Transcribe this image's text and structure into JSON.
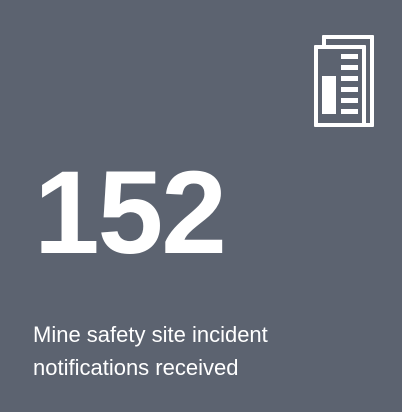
{
  "tile": {
    "icon": "document-report-icon",
    "value": "152",
    "caption_line1": "Mine safety site incident",
    "caption_line2": "notifications received",
    "background_color": "#5c6370",
    "text_color": "#ffffff"
  }
}
